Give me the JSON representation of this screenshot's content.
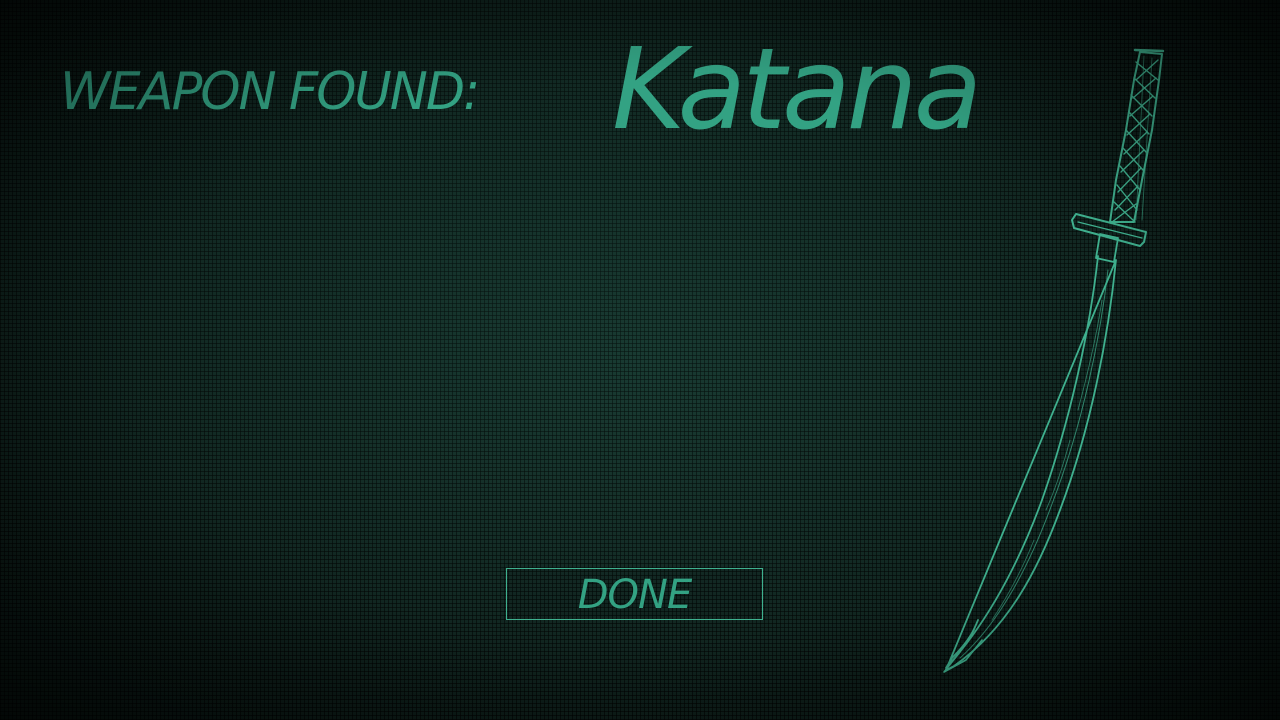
{
  "screen": {
    "heading_label": "WEAPON FOUND:",
    "weapon_name": "Katana",
    "done_label": "DONE"
  },
  "weapon_icon": "katana-icon",
  "colors": {
    "accent": "#33a283",
    "accent_light": "#3fb08e",
    "background": "#0b1a16"
  }
}
